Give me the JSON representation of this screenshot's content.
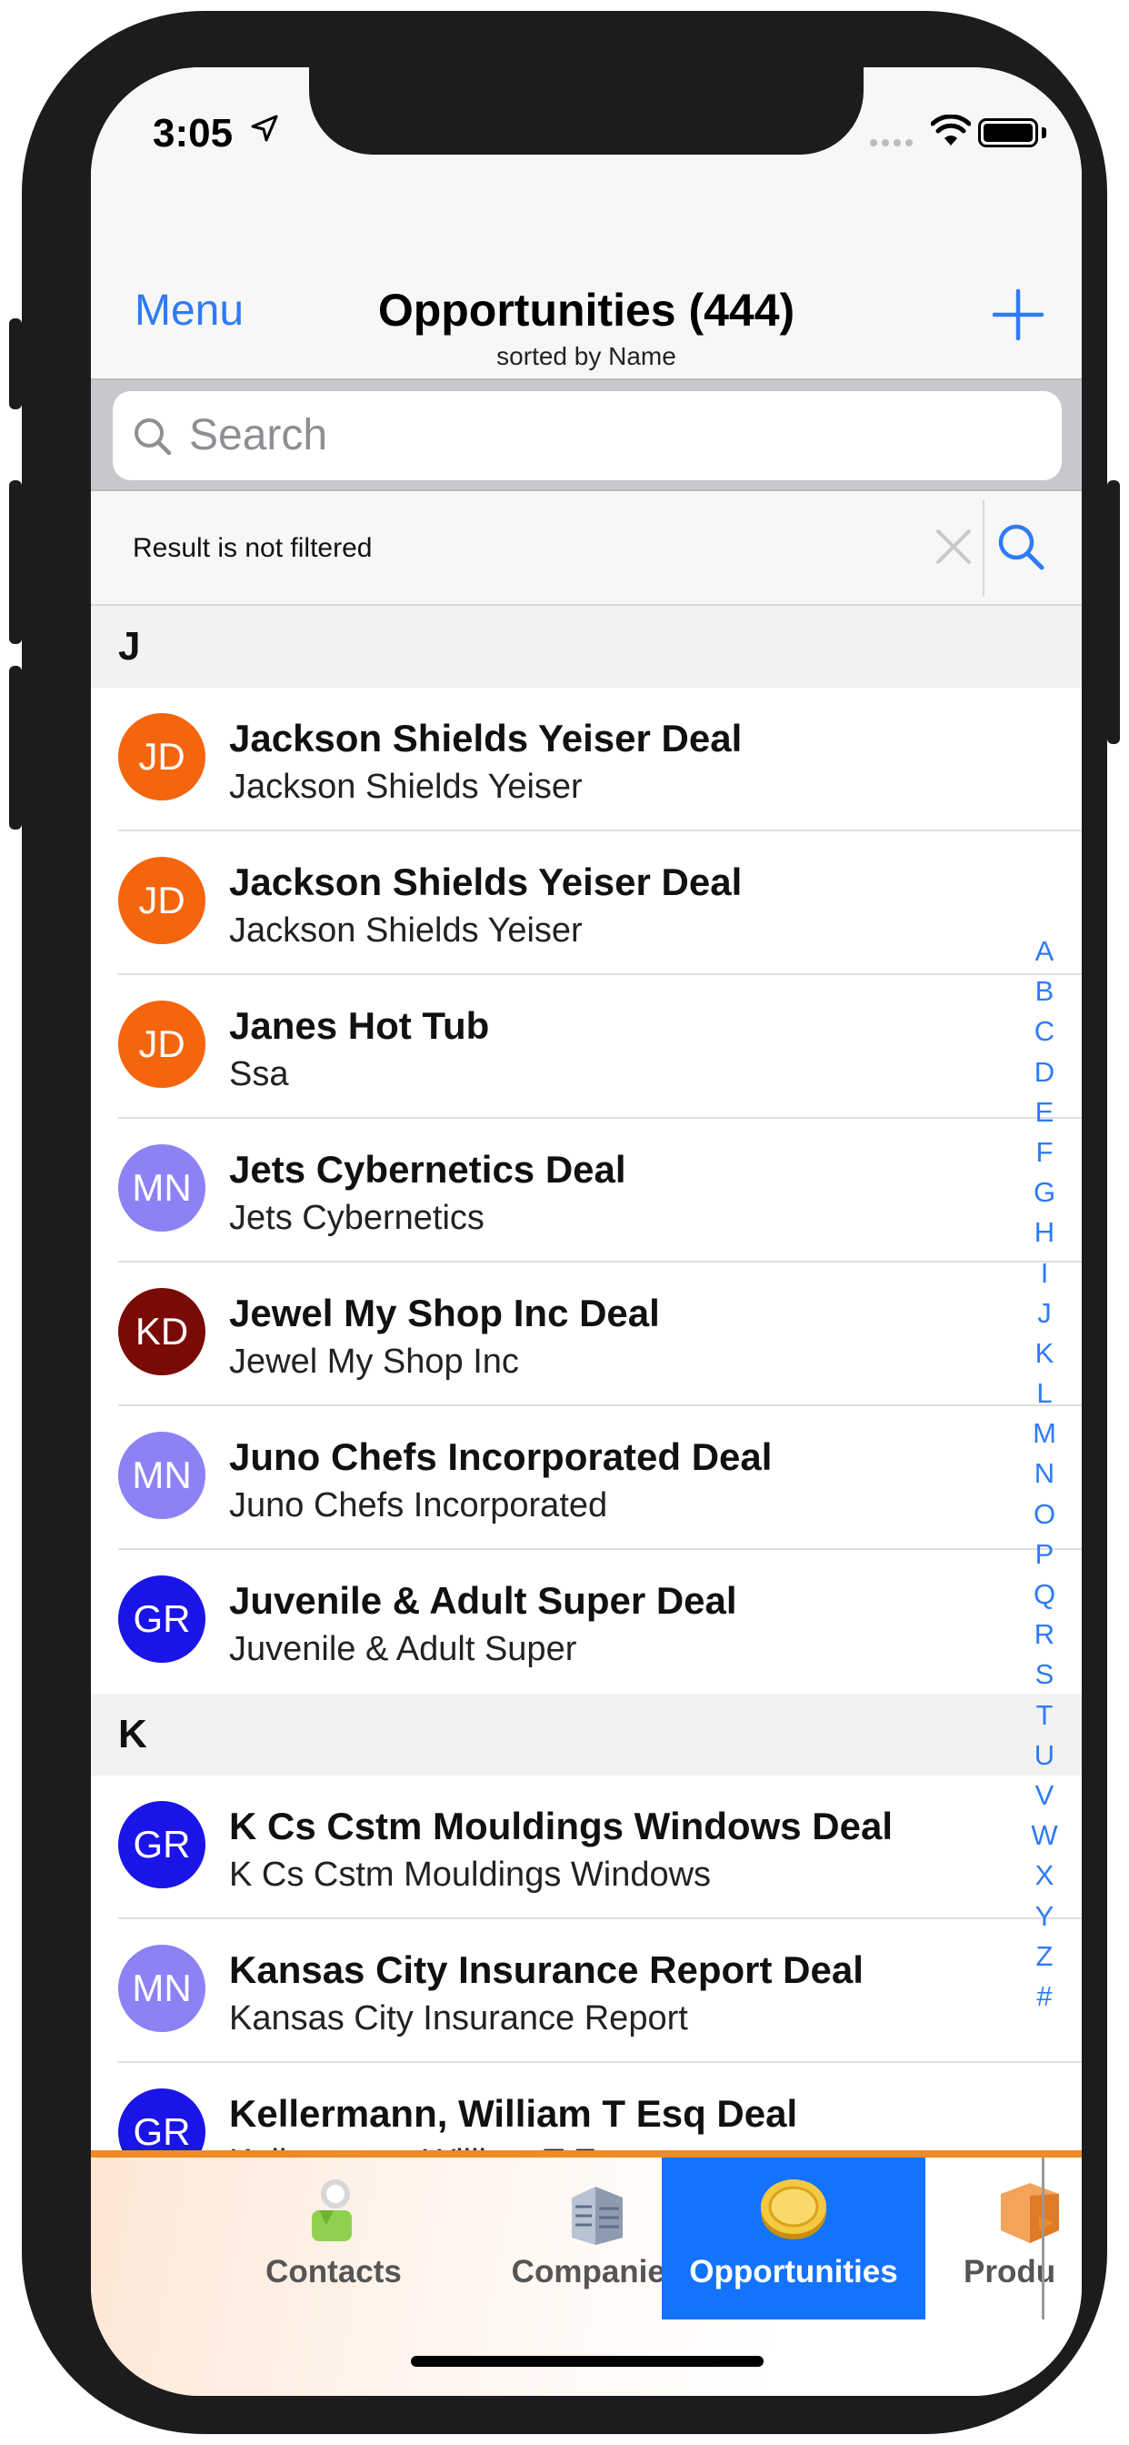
{
  "status_bar": {
    "time": "3:05"
  },
  "nav": {
    "menu_label": "Menu",
    "title": "Opportunities (444)",
    "subtitle": "sorted by Name"
  },
  "search": {
    "placeholder": "Search"
  },
  "filter": {
    "status_text": "Result is not filtered"
  },
  "sections": [
    {
      "letter": "J",
      "rows": [
        {
          "initials": "JD",
          "color": "#f4650e",
          "title": "Jackson Shields Yeiser Deal",
          "subtitle": "Jackson Shields Yeiser"
        },
        {
          "initials": "JD",
          "color": "#f4650e",
          "title": "Jackson Shields Yeiser Deal",
          "subtitle": "Jackson Shields Yeiser"
        },
        {
          "initials": "JD",
          "color": "#f4650e",
          "title": "Janes Hot Tub",
          "subtitle": "Ssa"
        },
        {
          "initials": "MN",
          "color": "#8c82f5",
          "title": "Jets Cybernetics Deal",
          "subtitle": "Jets Cybernetics"
        },
        {
          "initials": "KD",
          "color": "#7a0a06",
          "title": "Jewel My Shop Inc Deal",
          "subtitle": "Jewel My Shop Inc"
        },
        {
          "initials": "MN",
          "color": "#8c82f5",
          "title": "Juno Chefs Incorporated Deal",
          "subtitle": "Juno Chefs Incorporated"
        },
        {
          "initials": "GR",
          "color": "#1a14e8",
          "title": "Juvenile & Adult Super Deal",
          "subtitle": "Juvenile & Adult Super"
        }
      ]
    },
    {
      "letter": "K",
      "rows": [
        {
          "initials": "GR",
          "color": "#1a14e8",
          "title": "K Cs Cstm Mouldings Windows Deal",
          "subtitle": "K Cs Cstm Mouldings Windows"
        },
        {
          "initials": "MN",
          "color": "#8c82f5",
          "title": "Kansas City Insurance Report Deal",
          "subtitle": "Kansas City Insurance Report"
        },
        {
          "initials": "GR",
          "color": "#1a14e8",
          "title": "Kellermann, William T Esq Deal",
          "subtitle": "Kellermann, William T Esq"
        }
      ]
    }
  ],
  "index_letters": [
    "A",
    "B",
    "C",
    "D",
    "E",
    "F",
    "G",
    "H",
    "I",
    "J",
    "K",
    "L",
    "M",
    "N",
    "O",
    "P",
    "Q",
    "R",
    "S",
    "T",
    "U",
    "V",
    "W",
    "X",
    "Y",
    "Z",
    "#"
  ],
  "tabs": [
    {
      "label": "Contacts",
      "icon": "contacts-icon",
      "active": false
    },
    {
      "label": "Companies",
      "icon": "companies-icon",
      "active": false
    },
    {
      "label": "Opportunities",
      "icon": "opportunities-coin-icon",
      "active": true
    },
    {
      "label": "Produ",
      "icon": "products-box-icon",
      "active": false
    }
  ],
  "colors": {
    "accent": "#2f7bf6",
    "active_tab": "#1473fd",
    "tab_topline": "#f08a24"
  }
}
